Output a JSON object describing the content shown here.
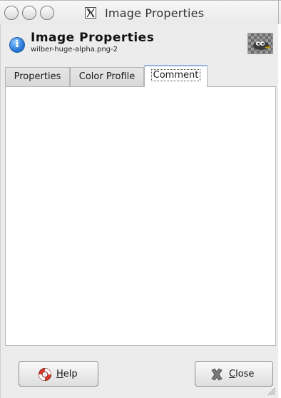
{
  "window": {
    "title": "Image Properties"
  },
  "header": {
    "title": "Image Properties",
    "subtitle": "wilber-huge-alpha.png-2"
  },
  "tabs": [
    {
      "label": "Properties",
      "active": false
    },
    {
      "label": "Color Profile",
      "active": false
    },
    {
      "label": "Comment",
      "active": true
    }
  ],
  "comment": {
    "text": ""
  },
  "buttons": {
    "help": {
      "mnemonic": "H",
      "rest": "elp"
    },
    "close": {
      "mnemonic": "C",
      "rest": "lose"
    }
  },
  "icons": {
    "header": "info-icon",
    "help": "lifebuoy-icon",
    "close": "close-icon"
  },
  "colors": {
    "info_blue": "#2a7ad8",
    "tab_focus": "#8fb4e0",
    "dialog_bg": "#ececec"
  }
}
